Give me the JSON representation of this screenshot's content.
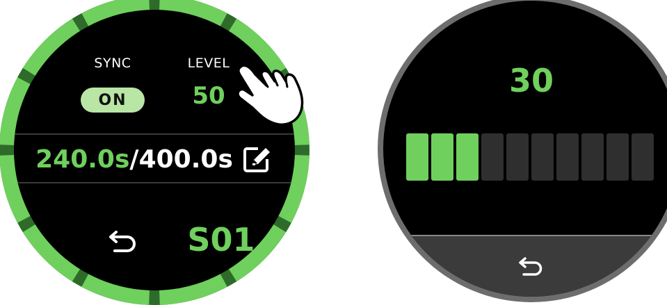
{
  "left_dial": {
    "sync_label": "SYNC",
    "sync_value": "ON",
    "level_label": "LEVEL",
    "level_value": "50",
    "time_elapsed": "240.0s",
    "time_separator": "/",
    "time_total": "400.0s",
    "scene": "S01",
    "colors": {
      "accent": "#6fd05d",
      "pill": "#b9e6a4",
      "ring_dark": "#2e6b2a"
    }
  },
  "right_dial": {
    "level_value": "30",
    "bars_total": 10,
    "bars_lit": 3,
    "colors": {
      "lit": "#6fd05d",
      "unlit": "#2f2f2f",
      "bezel": "#6d6d6d"
    }
  },
  "icons": {
    "edit": "pencil-square-icon",
    "back": "return-arrow-icon",
    "pointer": "pointing-hand-icon"
  }
}
